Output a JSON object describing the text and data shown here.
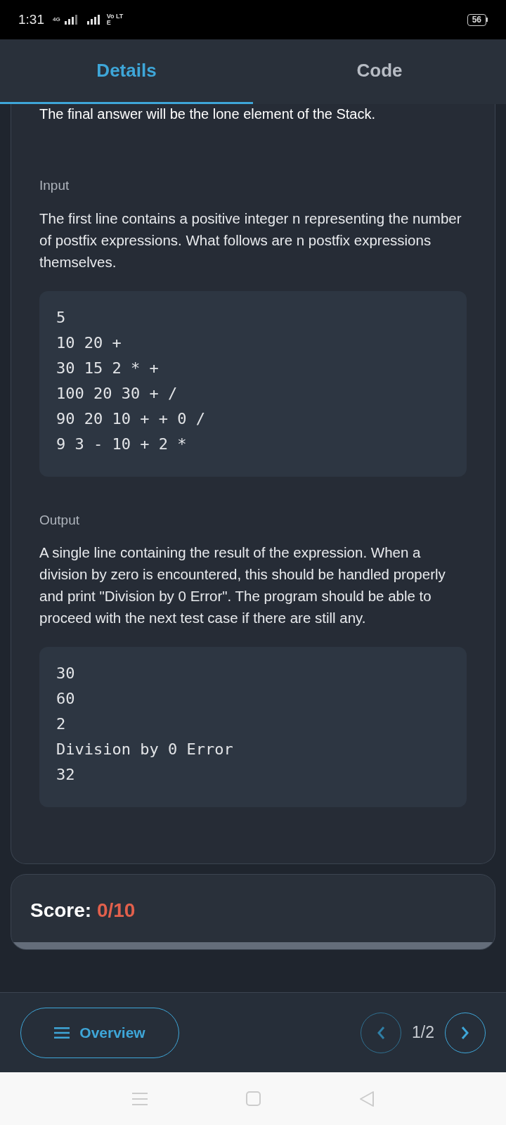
{
  "status_bar": {
    "time": "1:31",
    "network": "4G",
    "volte": "Vo LTE",
    "battery": "56"
  },
  "tabs": [
    {
      "label": "Details",
      "selected": true
    },
    {
      "label": "Code",
      "selected": false
    }
  ],
  "details": {
    "cut_line": "The final answer will be the lone element of the Stack.",
    "sections": [
      {
        "heading": "Input",
        "text": "The first line contains a positive integer n representing the number of postfix expressions. What follows are n postfix expressions themselves.",
        "code": [
          "5",
          "10 20 +",
          "30 15 2 * +",
          "100 20 30 + /",
          "90 20 10 + + 0 /",
          "9 3 - 10 + 2 *"
        ]
      },
      {
        "heading": "Output",
        "text": "A single line containing the result of the expression. When a division by zero is encountered, this should be handled properly and print \"Division by 0 Error\". The program should be able to proceed with the next test case if there are still any.",
        "code": [
          "30",
          "60",
          "2",
          "Division by 0 Error",
          "32"
        ]
      }
    ]
  },
  "score": {
    "label": "Score:",
    "value": "0/10",
    "level": 0
  },
  "footer": {
    "overview": "Overview",
    "page": "1/2"
  }
}
